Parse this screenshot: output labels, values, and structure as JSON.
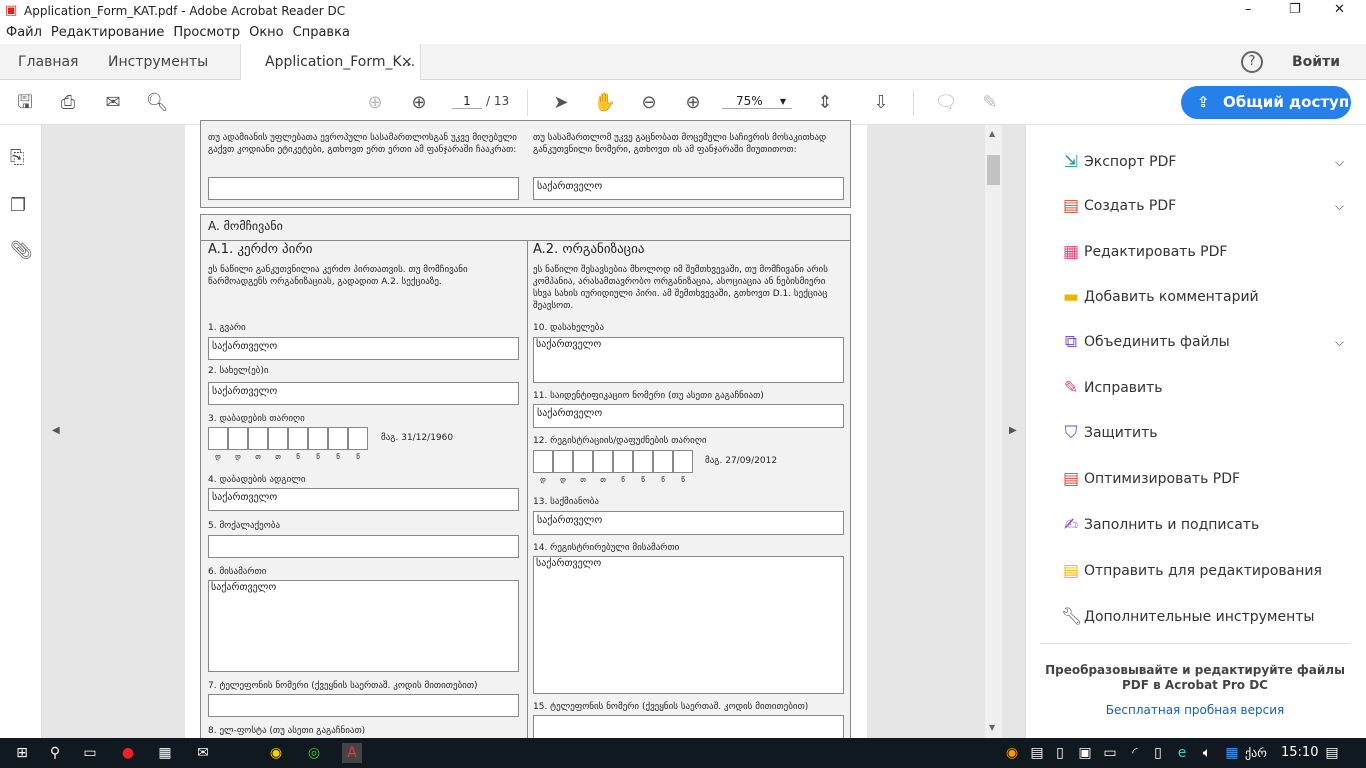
{
  "window": {
    "title": "Application_Form_KAT.pdf - Adobe Acrobat Reader DC",
    "minimize": "–",
    "restore": "❐",
    "close": "✕"
  },
  "menu": [
    "Файл",
    "Редактирование",
    "Просмотр",
    "Окно",
    "Справка"
  ],
  "tabs": {
    "home": "Главная",
    "tools": "Инструменты",
    "document": "Application_Form_K...",
    "close": "×",
    "help": "?",
    "signin": "Войти"
  },
  "toolbar": {
    "page_current": "1",
    "page_total": "/ 13",
    "zoom": "75%",
    "share": "Общий доступ"
  },
  "form": {
    "top_left_text": "თუ ადამიანის უფლებათა ევროპული სასამართლოსგან უკვე მიღებული გაქვთ კოდიანი ეტიკეტები, გთხოვთ ერთ ერთი ამ ფანჯარაში ჩააკრათ:",
    "top_left_value": "",
    "top_right_text": "თუ სასამართლომ უკვე გაცნობათ მოცემული საჩივრის მოსაკითხად განკუთვნილი ნომერი, გთხოვთ ის ამ ფანჯარაში მიუთითოთ:",
    "top_right_value": "საქართველო",
    "section_title": "A. მომჩივანი",
    "a1_title": "A.1. კერძო პირი",
    "a1_desc": "ეს ნაწილი განკუთვნილია კერძო პირთათვის. თუ მომჩივანი წარმოადგენს ორგანიზაციას, გადადით A.2. სექციაზე.",
    "a2_title": "A.2. ორგანიზაცია",
    "a2_desc": "ეს ნაწილი შესავსებია მხოლოდ იმ შემთხვევაში, თუ მომჩივანი არის კომპანია, არასამთავრობო ორგანიზაცია, ასოციაცია ან ნებისმიერი სხვა სახის იურიდიული პირი. ამ შემთხვევაში, გთხოვთ D.1. სექციაც შეავსოთ.",
    "f1_label": "1. გვარი",
    "f1_value": "საქართველო",
    "f2_label": "2. სახელ(ებ)ი",
    "f2_value": "საქართველო",
    "f3_label": "3. დაბადების თარიღი",
    "f3_example": "მაგ. 31/12/1960",
    "date_letters": [
      "დ",
      "დ",
      "თ",
      "თ",
      "წ",
      "წ",
      "წ",
      "წ"
    ],
    "f4_label": "4. დაბადების ადგილი",
    "f4_value": "საქართველო",
    "f5_label": "5. მოქალაქეობა",
    "f5_value": "",
    "f6_label": "6. მისამართი",
    "f6_value": "საქართველო",
    "f7_label": "7. ტელეფონის ნომერი (ქვეყნის საერთაშ. კოდის მითითებით)",
    "f7_value": "",
    "f8_label": "8. ელ-ფოსტა (თუ ასეთი გაგაჩნიათ)",
    "f10_label": "10. დასახელება",
    "f10_value": "საქართველო",
    "f11_label": "11. საიდენტიფიკაციო ნომერი (თუ ასეთი გაგაჩნიათ)",
    "f11_value": "საქართველო",
    "f12_label": "12. რეგისტრაციის/დაფუძნების თარიღი",
    "f12_example": "მაგ. 27/09/2012",
    "f13_label": "13. საქმიანობა",
    "f13_value": "საქართველო",
    "f14_label": "14. რეგისტრირებული მისამართი",
    "f14_value": "საქართველო",
    "f15_label": "15. ტელეფონის ნომერი (ქვეყნის საერთაშ. კოდის მითითებით)",
    "f15_value": ""
  },
  "right_panel": {
    "items": [
      {
        "label": "Экспорт PDF",
        "icon": "export-pdf-icon",
        "color": "#1a9a8a"
      },
      {
        "label": "Создать PDF",
        "icon": "create-pdf-icon",
        "color": "#e0463c"
      },
      {
        "label": "Редактировать PDF",
        "icon": "edit-pdf-icon",
        "color": "#e0467a"
      },
      {
        "label": "Добавить комментарий",
        "icon": "comment-icon",
        "color": "#e8b800"
      },
      {
        "label": "Объединить файлы",
        "icon": "combine-icon",
        "color": "#7a4fd0"
      },
      {
        "label": "Исправить",
        "icon": "fix-icon",
        "color": "#e0467a"
      },
      {
        "label": "Защитить",
        "icon": "shield-icon",
        "color": "#5a5ad0"
      },
      {
        "label": "Оптимизировать PDF",
        "icon": "optimize-icon",
        "color": "#e0463c"
      },
      {
        "label": "Заполнить и подписать",
        "icon": "sign-icon",
        "color": "#8a4fd0"
      },
      {
        "label": "Отправить для редактирования",
        "icon": "send-icon",
        "color": "#e8b800"
      },
      {
        "label": "Дополнительные инструменты",
        "icon": "more-tools-icon",
        "color": "#555555"
      }
    ],
    "promo": "Преобразовывайте и редактируйте файлы PDF в Acrobat Pro DC",
    "trial": "Бесплатная пробная версия"
  },
  "taskbar": {
    "lang": "ქარ",
    "time": "15:10"
  },
  "colors": {
    "accent": "#2680eb"
  }
}
